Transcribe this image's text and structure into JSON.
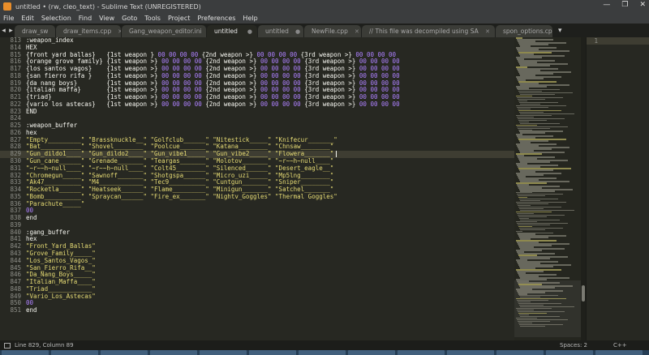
{
  "window": {
    "title": "untitled • (rw, cleo_text) - Sublime Text (UNREGISTERED)",
    "controls": [
      "—",
      "❐",
      "✕"
    ]
  },
  "menu": [
    "File",
    "Edit",
    "Selection",
    "Find",
    "View",
    "Goto",
    "Tools",
    "Project",
    "Preferences",
    "Help"
  ],
  "tabs": [
    {
      "label": "draw_sw",
      "active": false
    },
    {
      "label": "draw_items.cpp",
      "active": false
    },
    {
      "label": "Gang_weapon_editor.ini",
      "active": false
    },
    {
      "label": "untitled",
      "active": true
    },
    {
      "label": "untitled",
      "active": false
    },
    {
      "label": "NewFile.cpp",
      "active": false
    },
    {
      "label": "// This file was decompiled using SASCM.ini publis",
      "active": false
    },
    {
      "label": "spon_options.cpp",
      "active": false
    }
  ],
  "editor": {
    "lines": [
      {
        "n": "813",
        "t": ":weapon_index",
        "k": "plain"
      },
      {
        "n": "814",
        "t": "HEX",
        "k": "plain"
      },
      {
        "n": "815",
        "t": "{front yard ballas}   {1st weapon }",
        "h": " 00 00 00 00 ",
        "m": "{2nd weapon >}",
        "h2": " 00 00 00 00 ",
        "e": "{3rd weapon >}",
        "h3": " 00 00 00 00",
        "k": "hex"
      },
      {
        "n": "816",
        "t": "{orange grove family} {1st weapon >}",
        "h": " 00 00 00 00 ",
        "m": "{2nd weapon >}",
        "h2": " 00 00 00 00 ",
        "e": "{3rd weapon >}",
        "h3": " 00 00 00 00",
        "k": "hex"
      },
      {
        "n": "817",
        "t": "{los santos vagos}    {1st weapon >}",
        "h": " 00 00 00 00 ",
        "m": "{2nd weapon >}",
        "h2": " 00 00 00 00 ",
        "e": "{3rd weapon >}",
        "h3": " 00 00 00 00",
        "k": "hex"
      },
      {
        "n": "818",
        "t": "{san fierro rifa }    {1st weapon >}",
        "h": " 00 00 00 00 ",
        "m": "{2nd weapon >}",
        "h2": " 00 00 00 00 ",
        "e": "{3rd weapon >}",
        "h3": " 00 00 00 00",
        "k": "hex"
      },
      {
        "n": "819",
        "t": "{da nang boys}        {1st weapon >}",
        "h": " 00 00 00 00 ",
        "m": "{2nd weapon >}",
        "h2": " 00 00 00 00 ",
        "e": "{3rd weapon >}",
        "h3": " 00 00 00 00",
        "k": "hex"
      },
      {
        "n": "820",
        "t": "{italian maffa}       {1st weapon >}",
        "h": " 00 00 00 00 ",
        "m": "{2nd weapon >}",
        "h2": " 00 00 00 00 ",
        "e": "{3rd weapon >}",
        "h3": " 00 00 00 00",
        "k": "hex"
      },
      {
        "n": "821",
        "t": "{triad}               {1st weapon >}",
        "h": " 00 00 00 00 ",
        "m": "{2nd weapon >}",
        "h2": " 00 00 00 00 ",
        "e": "{3rd weapon >}",
        "h3": " 00 00 00 00",
        "k": "hex"
      },
      {
        "n": "822",
        "t": "{vario los astecas}   {1st weapon >}",
        "h": " 00 00 00 00 ",
        "m": "{2nd weapon >}",
        "h2": " 00 00 00 00 ",
        "e": "{3rd weapon >}",
        "h3": " 00 00 00 00",
        "k": "hex"
      },
      {
        "n": "823",
        "t": "END",
        "k": "plain"
      },
      {
        "n": "824",
        "t": "",
        "k": "plain"
      },
      {
        "n": "825",
        "t": ":weapon_buffer",
        "k": "plain"
      },
      {
        "n": "826",
        "t": "hex",
        "k": "plain"
      },
      {
        "n": "827",
        "t": "\"Empty_________\" \"Brassknuckle__\" \"Golfclub______\" \"Nitestick_____\" \"Knifecur_______\"",
        "k": "str"
      },
      {
        "n": "828",
        "t": "\"Bat___________\" \"Shovel________\" \"Poolcue_______\" \"Katana________\" \"Chnsaw________\"",
        "k": "str"
      },
      {
        "n": "829",
        "t": "\"Gun_dildo1____\" \"Gun_dildo2____\" \"Gun_vibe1_____\" \"Gun_vibe2_____\" \"Flowera_______\"",
        "k": "str",
        "current": true
      },
      {
        "n": "830",
        "t": "\"Gun_cane______\" \"Grenade_______\" \"Teargas_______\" \"Molotov_______\" \"~r~~h~null____\"",
        "k": "str"
      },
      {
        "n": "831",
        "t": "\"~r~~h~null____\" \"~r~~h~null____\" \"Colt45________\" \"Silenced______\" \"Desert_eagle__\"",
        "k": "str"
      },
      {
        "n": "832",
        "t": "\"Chromegun_____\" \"Sawnoff_______\" \"Shotgspa______\" \"Micro_uzi_____\" \"Mp5lng________\"",
        "k": "str"
      },
      {
        "n": "833",
        "t": "\"Ak47__________\" \"M4____________\" \"Tec9__________\" \"Cuntgun_______\" \"Sniper________\"",
        "k": "str"
      },
      {
        "n": "834",
        "t": "\"Rocketla______\" \"Heatseek______\" \"Flame_________\" \"Minigun_______\" \"Satchel_______\"",
        "k": "str"
      },
      {
        "n": "835",
        "t": "\"Bomb__________\" \"Spraycan______\" \"Fire_ex_______\" \"Nightv_Goggles\" \"Thermal Goggles\"",
        "k": "str"
      },
      {
        "n": "836",
        "t": "\"Parachute_____\"",
        "k": "str"
      },
      {
        "n": "837",
        "t": "00",
        "k": "num"
      },
      {
        "n": "838",
        "t": "end",
        "k": "plain"
      },
      {
        "n": "839",
        "t": "",
        "k": "plain"
      },
      {
        "n": "840",
        "t": ":gang_buffer",
        "k": "plain"
      },
      {
        "n": "841",
        "t": "hex",
        "k": "plain"
      },
      {
        "n": "842",
        "t": "\"Front_Yard_Ballas\"",
        "k": "str"
      },
      {
        "n": "843",
        "t": "\"Grove_Family_____\"",
        "k": "str"
      },
      {
        "n": "844",
        "t": "\"Los_Santos_Vagos_\"",
        "k": "str"
      },
      {
        "n": "845",
        "t": "\"San_Fierro_Rifa__\"",
        "k": "str"
      },
      {
        "n": "846",
        "t": "\"Da_Nang_Boys_____\"",
        "k": "str"
      },
      {
        "n": "847",
        "t": "\"Italian_Maffa____\"",
        "k": "str"
      },
      {
        "n": "848",
        "t": "\"Triad____________\"",
        "k": "str"
      },
      {
        "n": "849",
        "t": "\"Vario_Los_Astecas\"",
        "k": "str"
      },
      {
        "n": "850",
        "t": "00",
        "k": "num"
      },
      {
        "n": "851",
        "t": "end",
        "k": "plain"
      }
    ]
  },
  "split_pane": {
    "line_number": "1"
  },
  "status": {
    "position": "Line 829, Column 89",
    "spaces": "Spaces: 2",
    "syntax": "C++"
  },
  "colors": {
    "background": "#272822",
    "string": "#e6db74",
    "number": "#ae81ff",
    "text": "#f8f8f2",
    "gutter": "#8f908a"
  }
}
